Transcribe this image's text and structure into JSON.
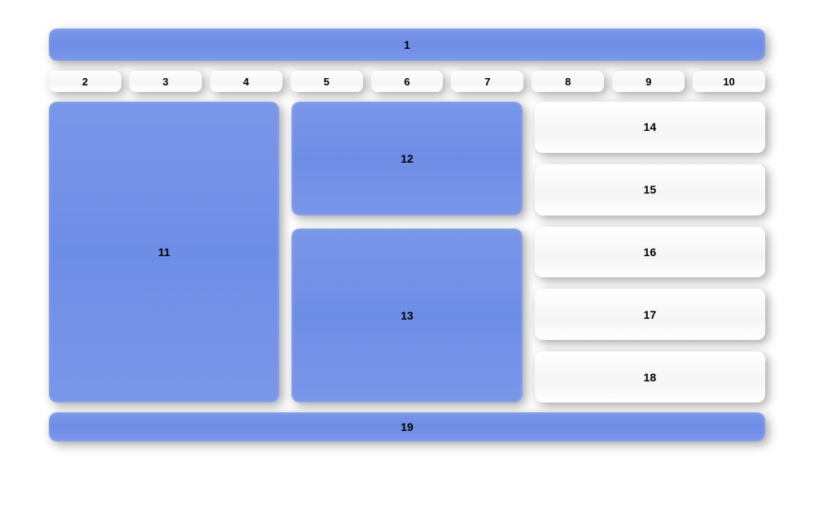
{
  "layout": {
    "header": {
      "label": "1"
    },
    "nav": {
      "group1": [
        {
          "label": "2"
        },
        {
          "label": "3"
        },
        {
          "label": "4"
        }
      ],
      "group2": [
        {
          "label": "5"
        },
        {
          "label": "6"
        },
        {
          "label": "7"
        }
      ],
      "group3": [
        {
          "label": "8"
        },
        {
          "label": "9"
        },
        {
          "label": "10"
        }
      ]
    },
    "main": {
      "left": {
        "label": "11"
      },
      "middle": [
        {
          "label": "12"
        },
        {
          "label": "13"
        }
      ],
      "right": [
        {
          "label": "14"
        },
        {
          "label": "15"
        },
        {
          "label": "16"
        },
        {
          "label": "17"
        },
        {
          "label": "18"
        }
      ]
    },
    "footer": {
      "label": "19"
    }
  },
  "colors": {
    "primary": "#7a96e8",
    "secondary": "#ffffff"
  }
}
